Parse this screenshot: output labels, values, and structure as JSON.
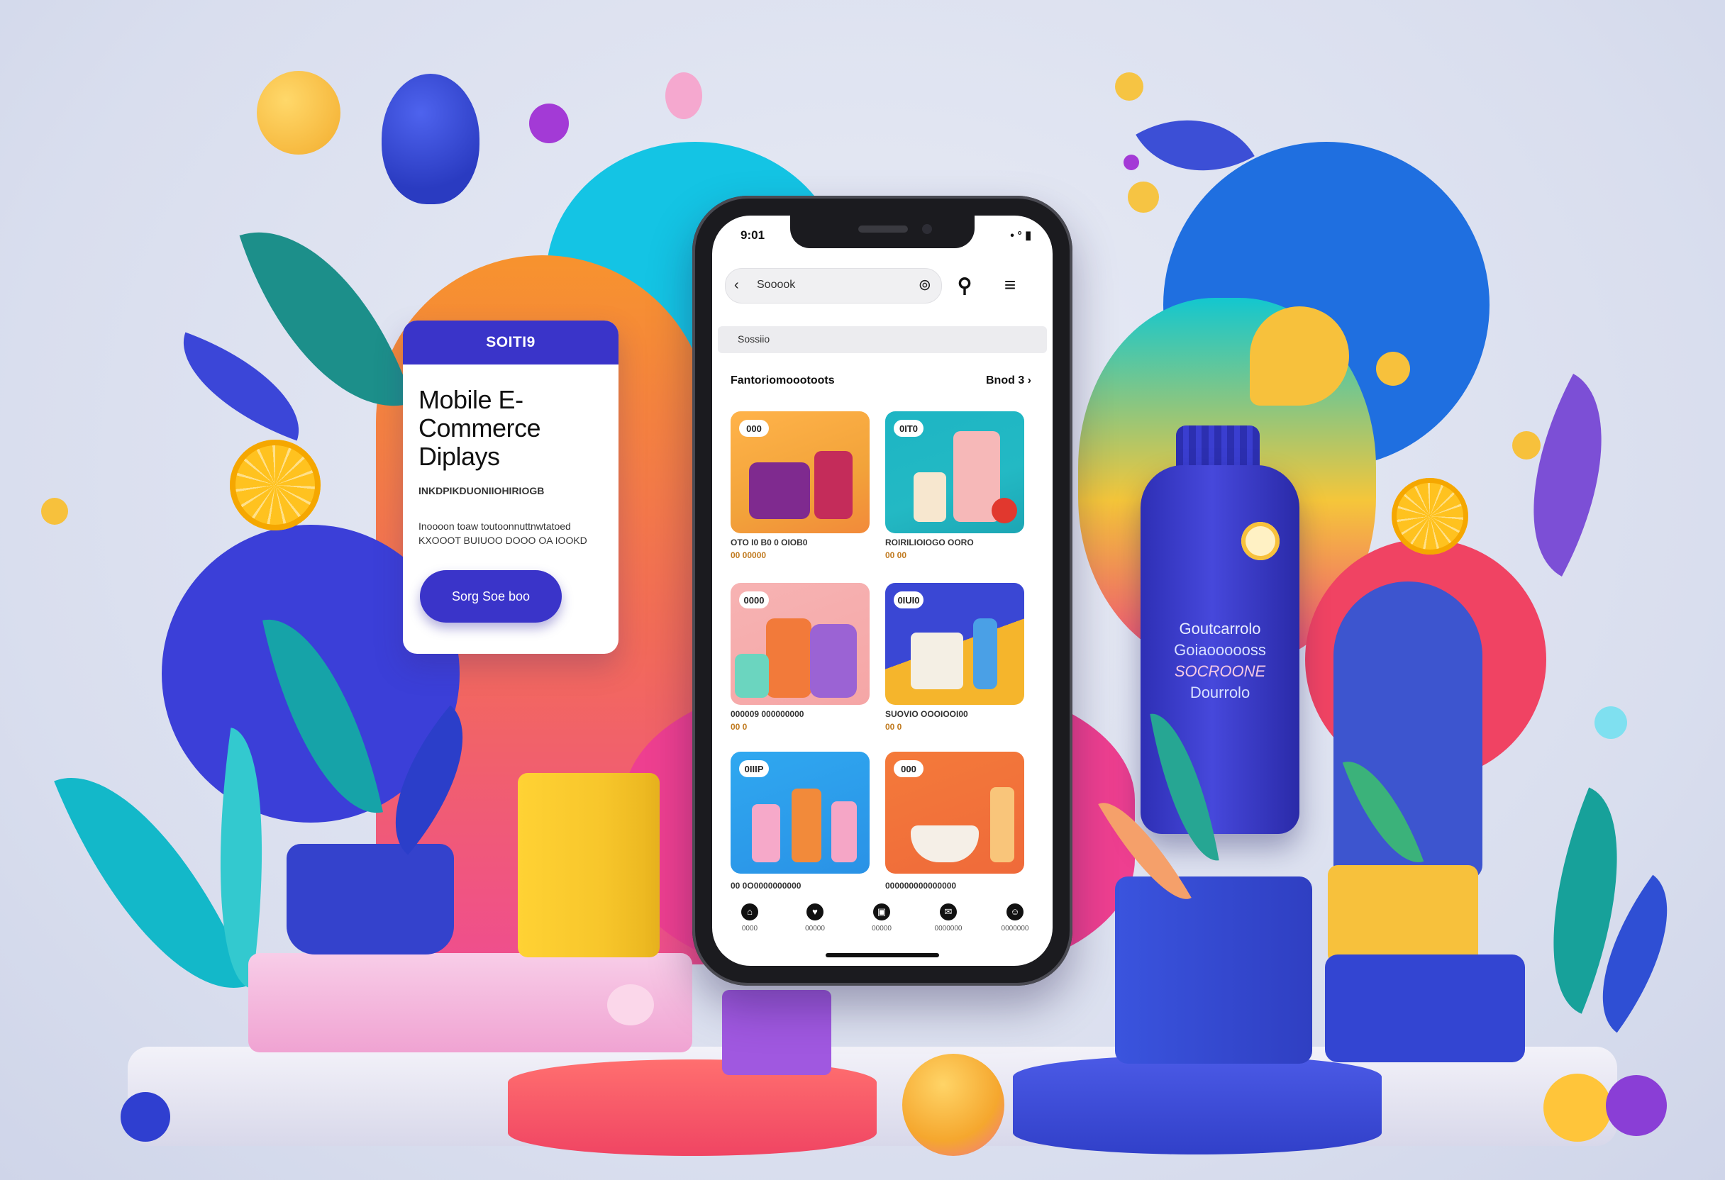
{
  "promo_card": {
    "header": "SOITI9",
    "title": "Mobile E-Commerce Diplays",
    "subtitle": "INKDPIKDUONIIOHIRIOGB",
    "body": "Inoooon toaw toutoonnuttnwtatoed KXOOOT BUIUOO DOOO OA IOOKD",
    "button_label": "Sorg Soe boo"
  },
  "phone": {
    "status": {
      "time": "9:01",
      "icons": "• ° ▮"
    },
    "search": {
      "placeholder": "Sooook",
      "lead_icon": "back-arrow-icon",
      "trail_icon": "scan-icon"
    },
    "subbar_text": "Sossiio",
    "section": {
      "title": "Fantoriomoootoots",
      "link": "Bnod 3 ›"
    },
    "products": [
      {
        "badge": "000",
        "name": "OTO I0 B0 0 OIOB0",
        "price": "00 00000"
      },
      {
        "badge": "0IT0",
        "name": "ROIRILIOIOGO OORO",
        "price": "00 00"
      },
      {
        "badge": "0000",
        "name": "000009 000000000",
        "price": "00 0"
      },
      {
        "badge": "0IUI0",
        "name": "SUOVIO OOOIOOI00",
        "price": "00 0"
      },
      {
        "badge": "0IIIP",
        "name": "00 0O0000000000",
        "price": ""
      },
      {
        "badge": "000",
        "name": "000000000000000",
        "price": ""
      }
    ],
    "tabs": [
      {
        "icon": "home-icon",
        "label": "0000"
      },
      {
        "icon": "heart-icon",
        "label": "00000"
      },
      {
        "icon": "bag-icon",
        "label": "00000"
      },
      {
        "icon": "chat-icon",
        "label": "0000000"
      },
      {
        "icon": "profile-icon",
        "label": "0000000"
      }
    ]
  },
  "bottle": {
    "line1": "Goutcarrolo",
    "line2": "Goiaoooooss",
    "line3": "SOCROONE",
    "line4": "Dourrolo"
  }
}
